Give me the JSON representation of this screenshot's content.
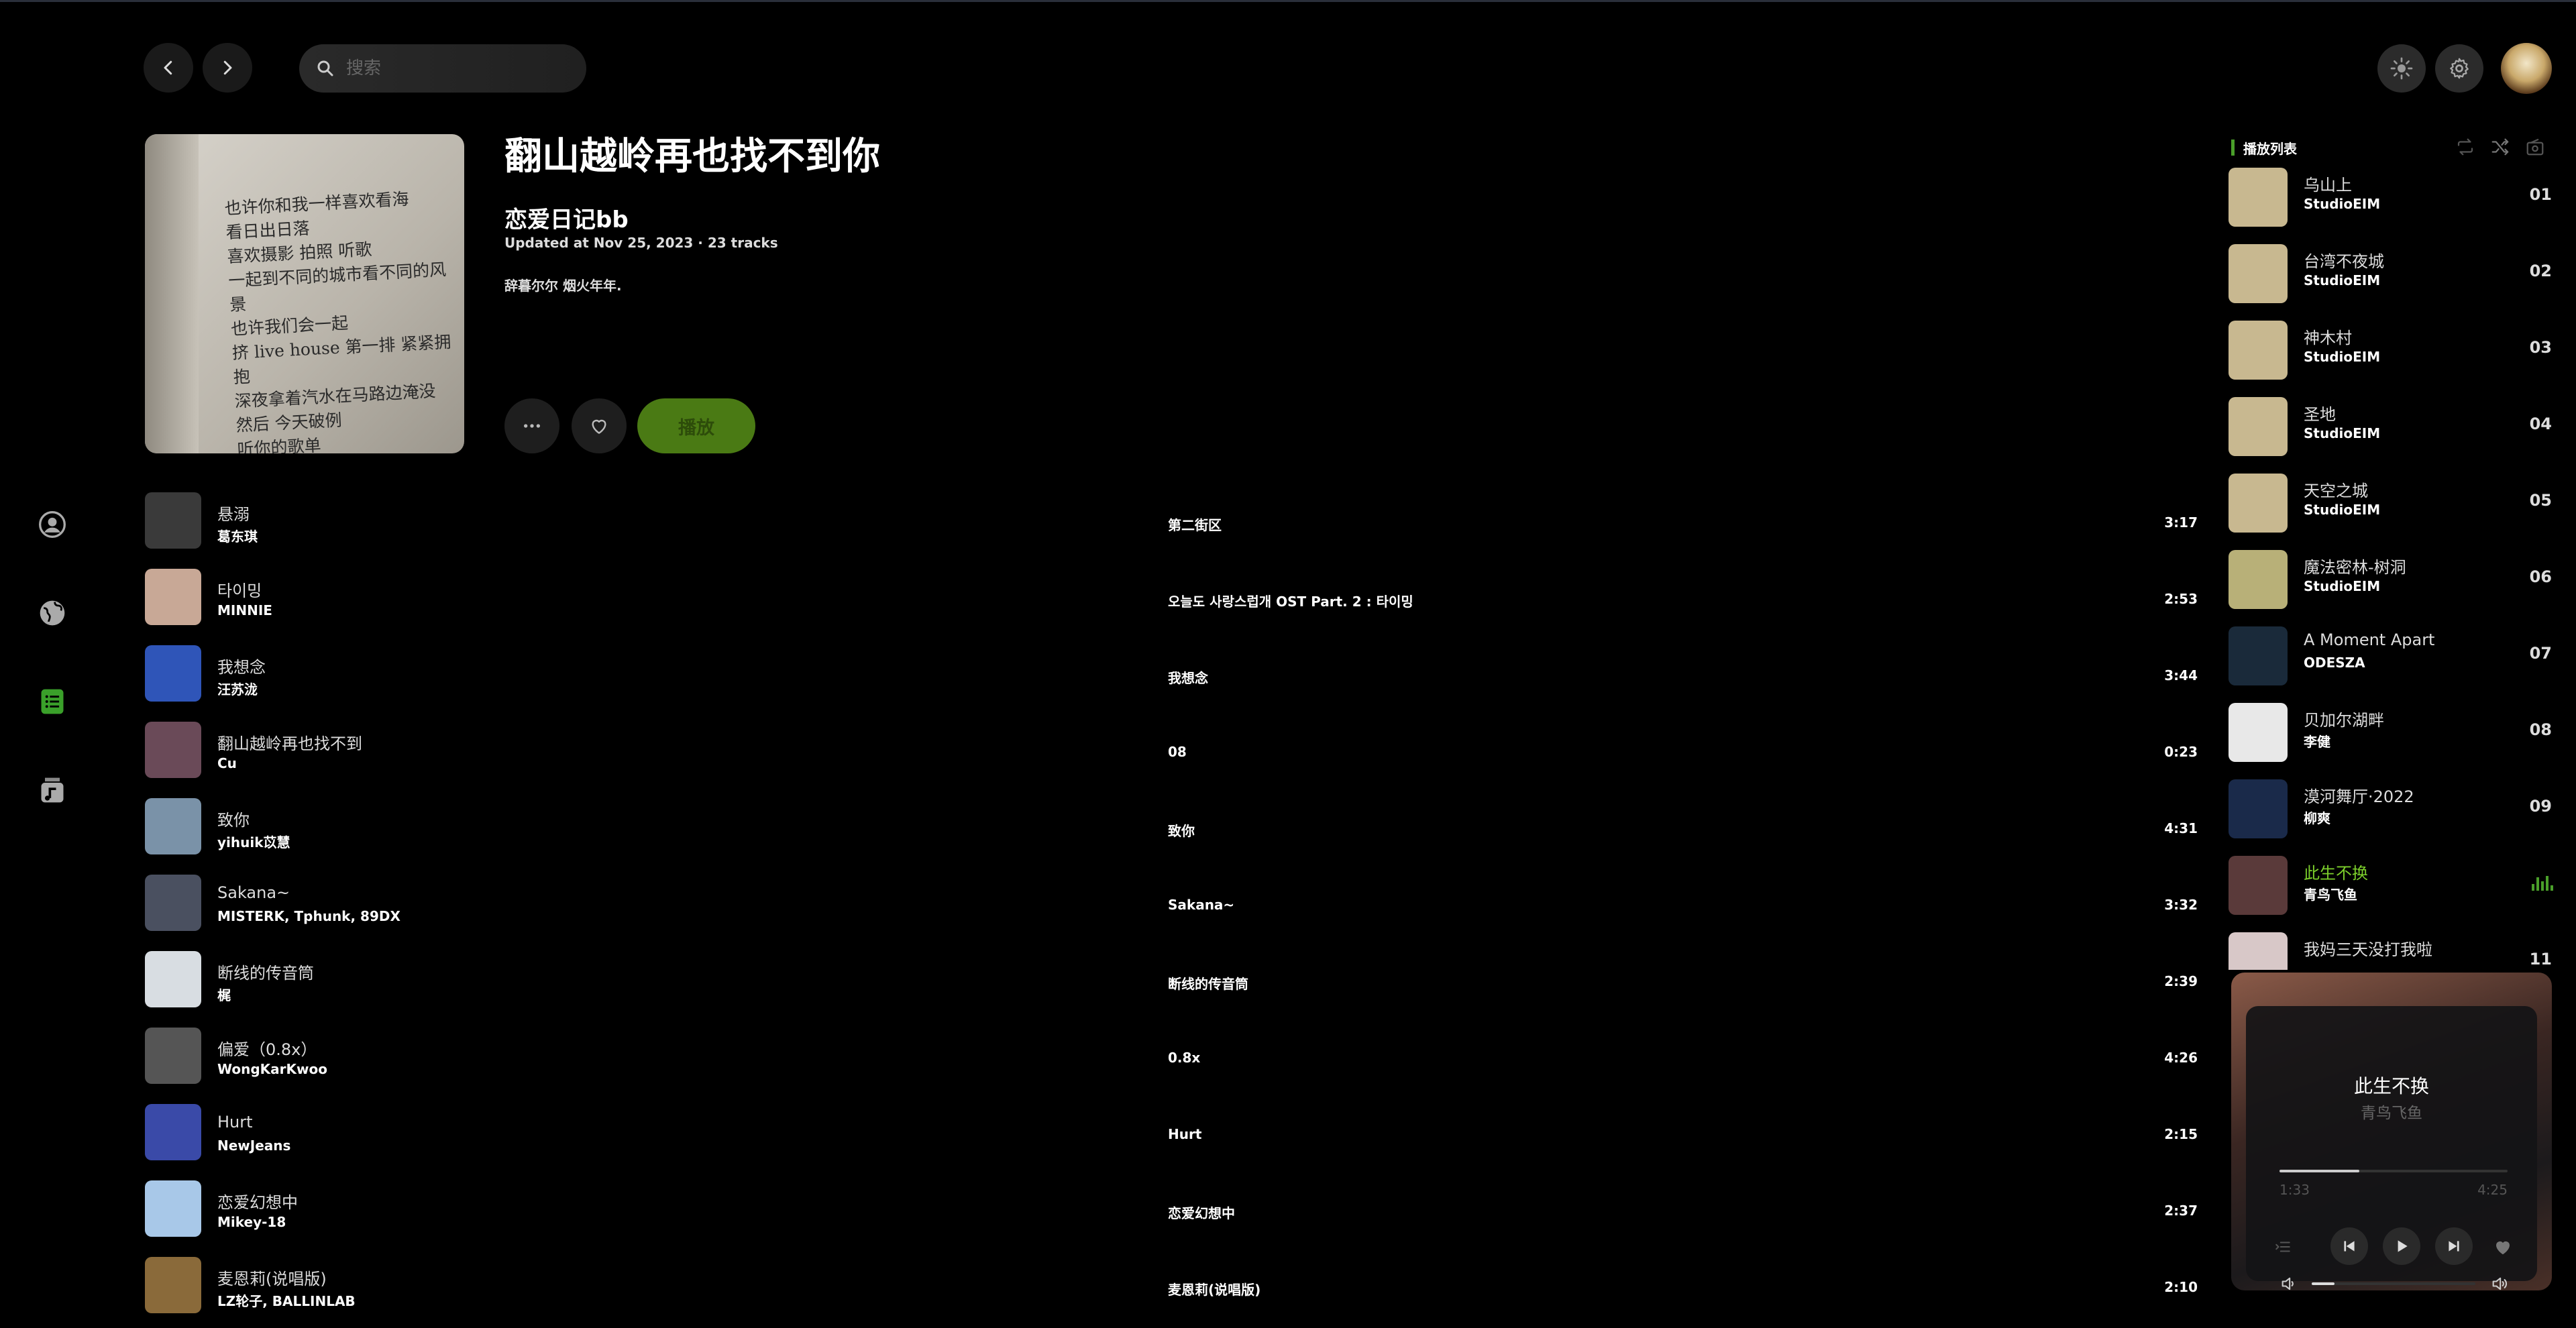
{
  "search": {
    "placeholder": "搜索"
  },
  "playlist": {
    "title": "翻山越岭再也找不到你",
    "creator": "恋爱日记bb",
    "updated": "Updated at Nov 25, 2023 · 23 tracks",
    "description": "辞暮尔尔 烟火年年.",
    "play_label": "播放",
    "cover_text": [
      "也许你和我一样喜欢看海",
      "看日出日落",
      "喜欢摄影 拍照 听歌",
      "一起到不同的城市看不同的风景",
      "也许我们会一起",
      "挤 live house 第一排 紧紧拥抱",
      "深夜拿着汽水在马路边淹没",
      "然后 今天破例",
      "听你的歌单"
    ]
  },
  "tracks": [
    {
      "name": "悬溺",
      "artist": "葛东琪",
      "album": "第二街区",
      "duration": "3:17",
      "thumb": "#3a3a3a"
    },
    {
      "name": "타이밍",
      "artist": "MINNIE",
      "album": "오늘도 사랑스럽개 OST Part. 2 : 타이밍",
      "duration": "2:53",
      "thumb": "#c8a896"
    },
    {
      "name": "我想念",
      "artist": "汪苏泷",
      "album": "我想念",
      "duration": "3:44",
      "thumb": "#2f55b8"
    },
    {
      "name": "翻山越岭再也找不到",
      "artist": "Cu",
      "album": "08",
      "duration": "0:23",
      "thumb": "#6a4a58"
    },
    {
      "name": "致你",
      "artist": "yihuik苡慧",
      "album": "致你",
      "duration": "4:31",
      "thumb": "#7a92a8"
    },
    {
      "name": "Sakana~",
      "artist": "MISTERK, Tphunk, 89DX",
      "album": "Sakana~",
      "duration": "3:32",
      "thumb": "#4a5060"
    },
    {
      "name": "断线的传音筒",
      "artist": "梶",
      "album": "断线的传音筒",
      "duration": "2:39",
      "thumb": "#d8dde2"
    },
    {
      "name": "偏爱（0.8x）",
      "artist": "WongKarKwoo",
      "album": "0.8x",
      "duration": "4:26",
      "thumb": "#555555"
    },
    {
      "name": "Hurt",
      "artist": "NewJeans",
      "album": "Hurt",
      "duration": "2:15",
      "thumb": "#3a4aa8"
    },
    {
      "name": "恋爱幻想中",
      "artist": "Mikey-18",
      "album": "恋爱幻想中",
      "duration": "2:37",
      "thumb": "#a8c8e8"
    },
    {
      "name": "麦恩莉(说唱版)",
      "artist": "LZ轮子, BALLINLAB",
      "album": "麦恩莉(说唱版)",
      "duration": "2:10",
      "thumb": "#8a6a3a"
    }
  ],
  "queue": {
    "label": "播放列表",
    "items": [
      {
        "name": "乌山上",
        "artist": "StudioEIM",
        "num": "01",
        "thumb": "#c8b890"
      },
      {
        "name": "台湾不夜城",
        "artist": "StudioEIM",
        "num": "02",
        "thumb": "#c8b890"
      },
      {
        "name": "神木村",
        "artist": "StudioEIM",
        "num": "03",
        "thumb": "#c8b890"
      },
      {
        "name": "圣地",
        "artist": "StudioEIM",
        "num": "04",
        "thumb": "#c8b890"
      },
      {
        "name": "天空之城",
        "artist": "StudioEIM",
        "num": "05",
        "thumb": "#c8b890"
      },
      {
        "name": "魔法密林-树洞",
        "artist": "StudioEIM",
        "num": "06",
        "thumb": "#b8b078"
      },
      {
        "name": "A Moment Apart",
        "artist": "ODESZA",
        "num": "07",
        "thumb": "#1a2a3a"
      },
      {
        "name": "贝加尔湖畔",
        "artist": "李健",
        "num": "08",
        "thumb": "#e8e8e8"
      },
      {
        "name": "漠河舞厅·2022",
        "artist": "柳爽",
        "num": "09",
        "thumb": "#1a2a4a"
      },
      {
        "name": "此生不换",
        "artist": "青鸟飞鱼",
        "num": "",
        "thumb": "#5a3a3a"
      },
      {
        "name": "我妈三天没打我啦",
        "artist": "",
        "num": "11",
        "thumb": "#d8c8c8"
      }
    ]
  },
  "player": {
    "title": "此生不换",
    "artist": "青鸟飞鱼",
    "current": "1:33",
    "total": "4:25",
    "progress": 0.35,
    "volume": 0.14
  },
  "colors": {
    "accent": "#4a7a14",
    "accent_text": "#7ccf2b",
    "background": "#000000"
  }
}
